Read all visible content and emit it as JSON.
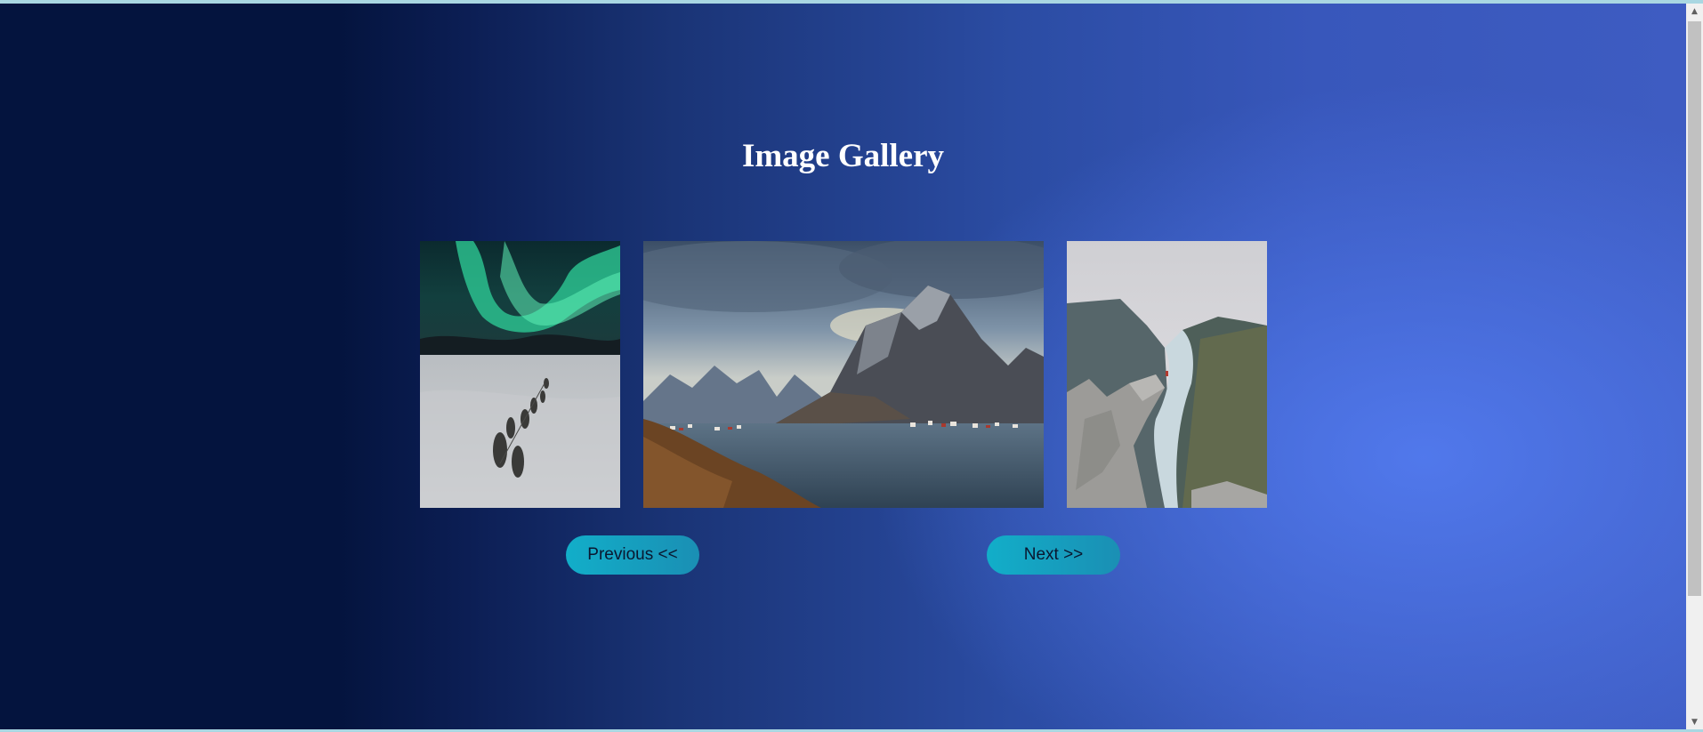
{
  "page": {
    "title": "Image Gallery"
  },
  "gallery": {
    "images": [
      {
        "name": "aurora-sled-dogs-image",
        "description_icon": "image"
      },
      {
        "name": "mountain-village-image",
        "description_icon": "image"
      },
      {
        "name": "fjord-cliff-image",
        "description_icon": "image"
      }
    ]
  },
  "controls": {
    "previous_label": "Previous <<",
    "next_label": "Next >>"
  },
  "scrollbar": {
    "up_icon": "▲",
    "down_icon": "▼"
  },
  "colors": {
    "button_start": "#12aec9",
    "button_end": "#1a8fb4",
    "title": "#ffffff"
  }
}
